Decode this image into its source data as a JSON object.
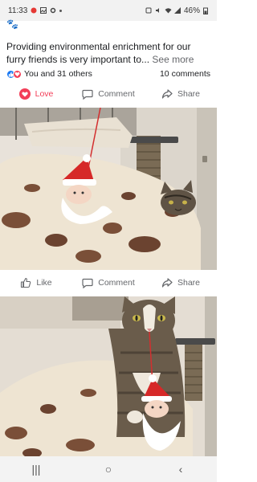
{
  "status_bar": {
    "time": "11:33",
    "battery": "46%",
    "icons": [
      "notification-icon",
      "image-icon",
      "settings-icon",
      "alarm-icon",
      "mute-icon",
      "wifi-icon",
      "signal-icon",
      "battery-icon"
    ]
  },
  "post": {
    "paw_emoji": "🐾",
    "caption": "Providing environmental enrichment for our furry friends is very important to...",
    "see_more": "See more"
  },
  "reactions": {
    "summary": "You and 31 others",
    "comments": "10 comments",
    "icons": [
      "like-reaction-icon",
      "love-reaction-icon"
    ]
  },
  "actions_top": {
    "love": "Love",
    "comment": "Comment",
    "share": "Share"
  },
  "actions_mid": {
    "like": "Like",
    "comment": "Comment",
    "share": "Share"
  },
  "nav_bar": {
    "recents": "|||",
    "home": "○",
    "back": "‹"
  },
  "colors": {
    "love": "#f33e58",
    "like_blue": "#1877f2",
    "muted": "#65676b"
  }
}
